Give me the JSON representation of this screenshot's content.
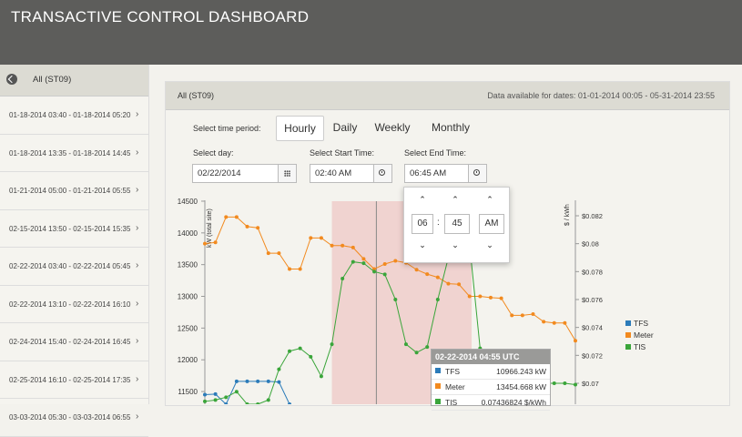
{
  "header": {
    "title": "TRANSACTIVE CONTROL DASHBOARD"
  },
  "sidebar": {
    "title": "All (ST09)",
    "items": [
      "01-18-2014 03:40 - 01-18-2014 05:20",
      "01-18-2014 13:35 - 01-18-2014 14:45",
      "01-21-2014 05:00 - 01-21-2014 05:55",
      "02-15-2014 13:50 - 02-15-2014 15:35",
      "02-22-2014 03:40 - 02-22-2014 05:45",
      "02-22-2014 13:10 - 02-22-2014 16:10",
      "02-24-2014 15:40 - 02-24-2014 16:45",
      "02-25-2014 16:10 - 02-25-2014 17:35",
      "03-03-2014 05:30 - 03-03-2014 06:55"
    ]
  },
  "panel": {
    "title": "All (ST09)",
    "availability": "Data available for dates: 01-01-2014 00:05 - 05-31-2014 23:55",
    "period_label": "Select time period:",
    "periods": [
      "Hourly",
      "Daily",
      "Weekly",
      "Monthly"
    ],
    "active_period": "Hourly",
    "day_label": "Select day:",
    "day_value": "02/22/2014",
    "start_label": "Select Start Time:",
    "start_value": "02:40 AM",
    "end_label": "Select End Time:",
    "end_value": "06:45 AM"
  },
  "time_picker": {
    "hour": "06",
    "minute": "45",
    "meridian": "AM"
  },
  "tooltip": {
    "title": "02-22-2014 04:55 UTC",
    "rows": [
      {
        "name": "TFS",
        "value": "10966.243 kW",
        "color": "#2b7bb9"
      },
      {
        "name": "Meter",
        "value": "13454.668 kW",
        "color": "#f28a1f"
      },
      {
        "name": "TIS",
        "value": "0.07436824 $/kWh",
        "color": "#3aa53a"
      }
    ]
  },
  "legend": [
    {
      "name": "TFS",
      "color": "#2b7bb9"
    },
    {
      "name": "Meter",
      "color": "#f28a1f"
    },
    {
      "name": "TIS",
      "color": "#3aa53a"
    }
  ],
  "chart_data": {
    "type": "line",
    "ylabel": "kW (total site)",
    "y2label": "$ / kWh",
    "ylim": [
      11300,
      14600
    ],
    "y2lim": [
      0.0685,
      0.0835
    ],
    "yticks": [
      11500,
      12000,
      12500,
      13000,
      13500,
      14000,
      14500
    ],
    "y2ticks": [
      "$0.07",
      "$0.072",
      "$0.074",
      "$0.076",
      "$0.078",
      "$0.08",
      "$0.082"
    ],
    "y2tick_values": [
      0.07,
      0.072,
      0.074,
      0.076,
      0.078,
      0.08,
      0.082
    ],
    "highlight_x_range": [
      12,
      25.2
    ],
    "crosshair_x": 16.2,
    "series": [
      {
        "name": "Meter",
        "axis": "left",
        "x": [
          0,
          1,
          2,
          3,
          4,
          5,
          6,
          7,
          8,
          9,
          10,
          11,
          12,
          13,
          14,
          15,
          16,
          17,
          18,
          19,
          20,
          21,
          22,
          23,
          24,
          25,
          26,
          27,
          28,
          29,
          30,
          31,
          32,
          33,
          34,
          35
        ],
        "values": [
          13830,
          13850,
          14250,
          14250,
          14100,
          14080,
          13680,
          13680,
          13430,
          13430,
          13920,
          13920,
          13800,
          13800,
          13770,
          13590,
          13430,
          13510,
          13560,
          13530,
          13420,
          13350,
          13300,
          13200,
          13190,
          13000,
          13000,
          12980,
          12970,
          12700,
          12700,
          12720,
          12600,
          12580,
          12580,
          12300
        ]
      },
      {
        "name": "TFS",
        "axis": "left",
        "x": [
          0,
          1,
          2,
          3,
          4,
          5,
          6,
          7,
          8
        ],
        "values": [
          11450,
          11460,
          11300,
          11660,
          11660,
          11660,
          11660,
          11650,
          11300
        ]
      },
      {
        "name": "TIS",
        "axis": "right",
        "x": [
          0,
          1,
          2,
          3,
          4,
          5,
          6,
          7,
          8,
          9,
          10,
          11,
          12,
          13,
          14,
          15,
          16,
          17,
          18,
          19,
          20,
          21,
          22,
          23,
          24,
          25,
          26,
          27,
          28,
          29,
          30,
          31,
          32,
          33,
          34,
          35
        ],
        "values": [
          0.0687,
          0.0688,
          0.069,
          0.0694,
          0.0685,
          0.0685,
          0.0688,
          0.071,
          0.0723,
          0.0725,
          0.0719,
          0.0705,
          0.0728,
          0.0775,
          0.0787,
          0.0786,
          0.078,
          0.0778,
          0.076,
          0.0728,
          0.0722,
          0.0726,
          0.076,
          0.079,
          0.08,
          0.08,
          0.0725,
          0.07,
          0.07,
          0.07,
          0.07,
          0.07,
          0.07,
          0.07,
          0.07,
          0.0699
        ]
      }
    ]
  }
}
